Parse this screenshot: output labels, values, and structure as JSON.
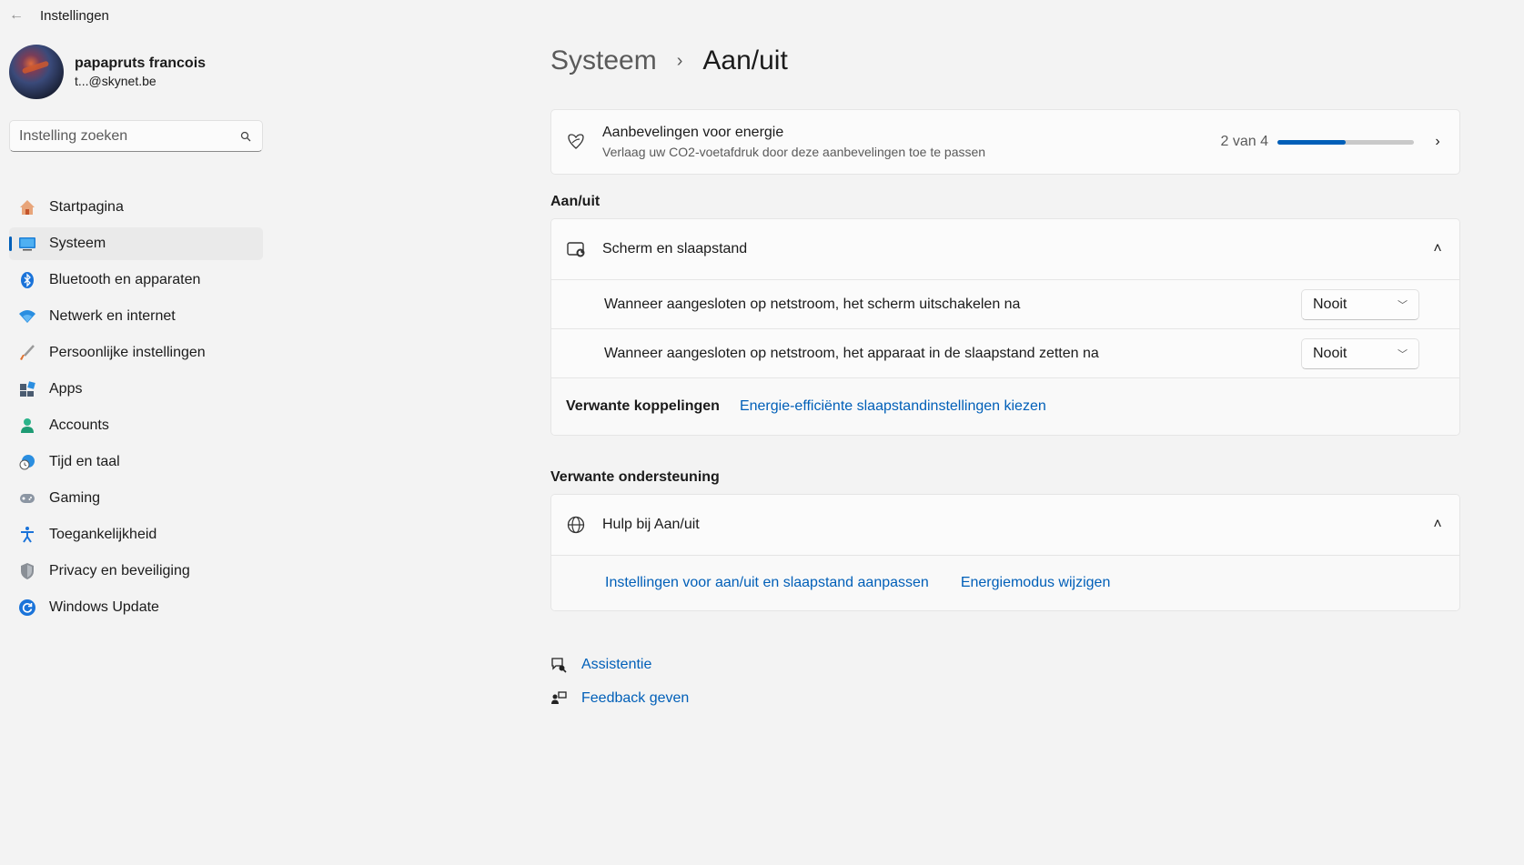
{
  "window": {
    "title": "Instellingen",
    "back_icon": "back-arrow-icon"
  },
  "profile": {
    "name": "papapruts francois",
    "email": "t...@skynet.be"
  },
  "search": {
    "placeholder": "Instelling zoeken",
    "value": ""
  },
  "sidebar": {
    "items": [
      {
        "label": "Startpagina",
        "icon": "home-icon"
      },
      {
        "label": "Systeem",
        "icon": "system-icon",
        "active": true
      },
      {
        "label": "Bluetooth en apparaten",
        "icon": "bluetooth-icon"
      },
      {
        "label": "Netwerk en internet",
        "icon": "wifi-icon"
      },
      {
        "label": "Persoonlijke instellingen",
        "icon": "brush-icon"
      },
      {
        "label": "Apps",
        "icon": "apps-icon"
      },
      {
        "label": "Accounts",
        "icon": "person-icon"
      },
      {
        "label": "Tijd en taal",
        "icon": "globe-clock-icon"
      },
      {
        "label": "Gaming",
        "icon": "gamepad-icon"
      },
      {
        "label": "Toegankelijkheid",
        "icon": "accessibility-icon"
      },
      {
        "label": "Privacy en beveiliging",
        "icon": "shield-icon"
      },
      {
        "label": "Windows Update",
        "icon": "refresh-icon"
      }
    ]
  },
  "breadcrumb": {
    "parent": "Systeem",
    "separator": "›",
    "current": "Aan/uit"
  },
  "energy": {
    "title": "Aanbevelingen voor energie",
    "subtitle": "Verlaag uw CO2-voetafdruk door deze aanbevelingen toe te passen",
    "progress_label": "2 van 4",
    "progress_fraction": 0.5
  },
  "power_section": {
    "title": "Aan/uit",
    "group_title": "Scherm en slaapstand",
    "rows": [
      {
        "label": "Wanneer aangesloten op netstroom, het scherm uitschakelen na",
        "value": "Nooit"
      },
      {
        "label": "Wanneer aangesloten op netstroom, het apparaat in de slaapstand zetten na",
        "value": "Nooit"
      }
    ],
    "related_label": "Verwante koppelingen",
    "related_link": "Energie-efficiënte slaapstandinstellingen kiezen"
  },
  "support_section": {
    "title": "Verwante ondersteuning",
    "group_title": "Hulp bij Aan/uit",
    "links": [
      "Instellingen voor aan/uit en slaapstand aanpassen",
      "Energiemodus wijzigen"
    ]
  },
  "footer": {
    "help": "Assistentie",
    "feedback": "Feedback geven"
  },
  "colors": {
    "accent": "#005fb8",
    "background": "#f3f3f3",
    "card": "#fbfbfb"
  }
}
